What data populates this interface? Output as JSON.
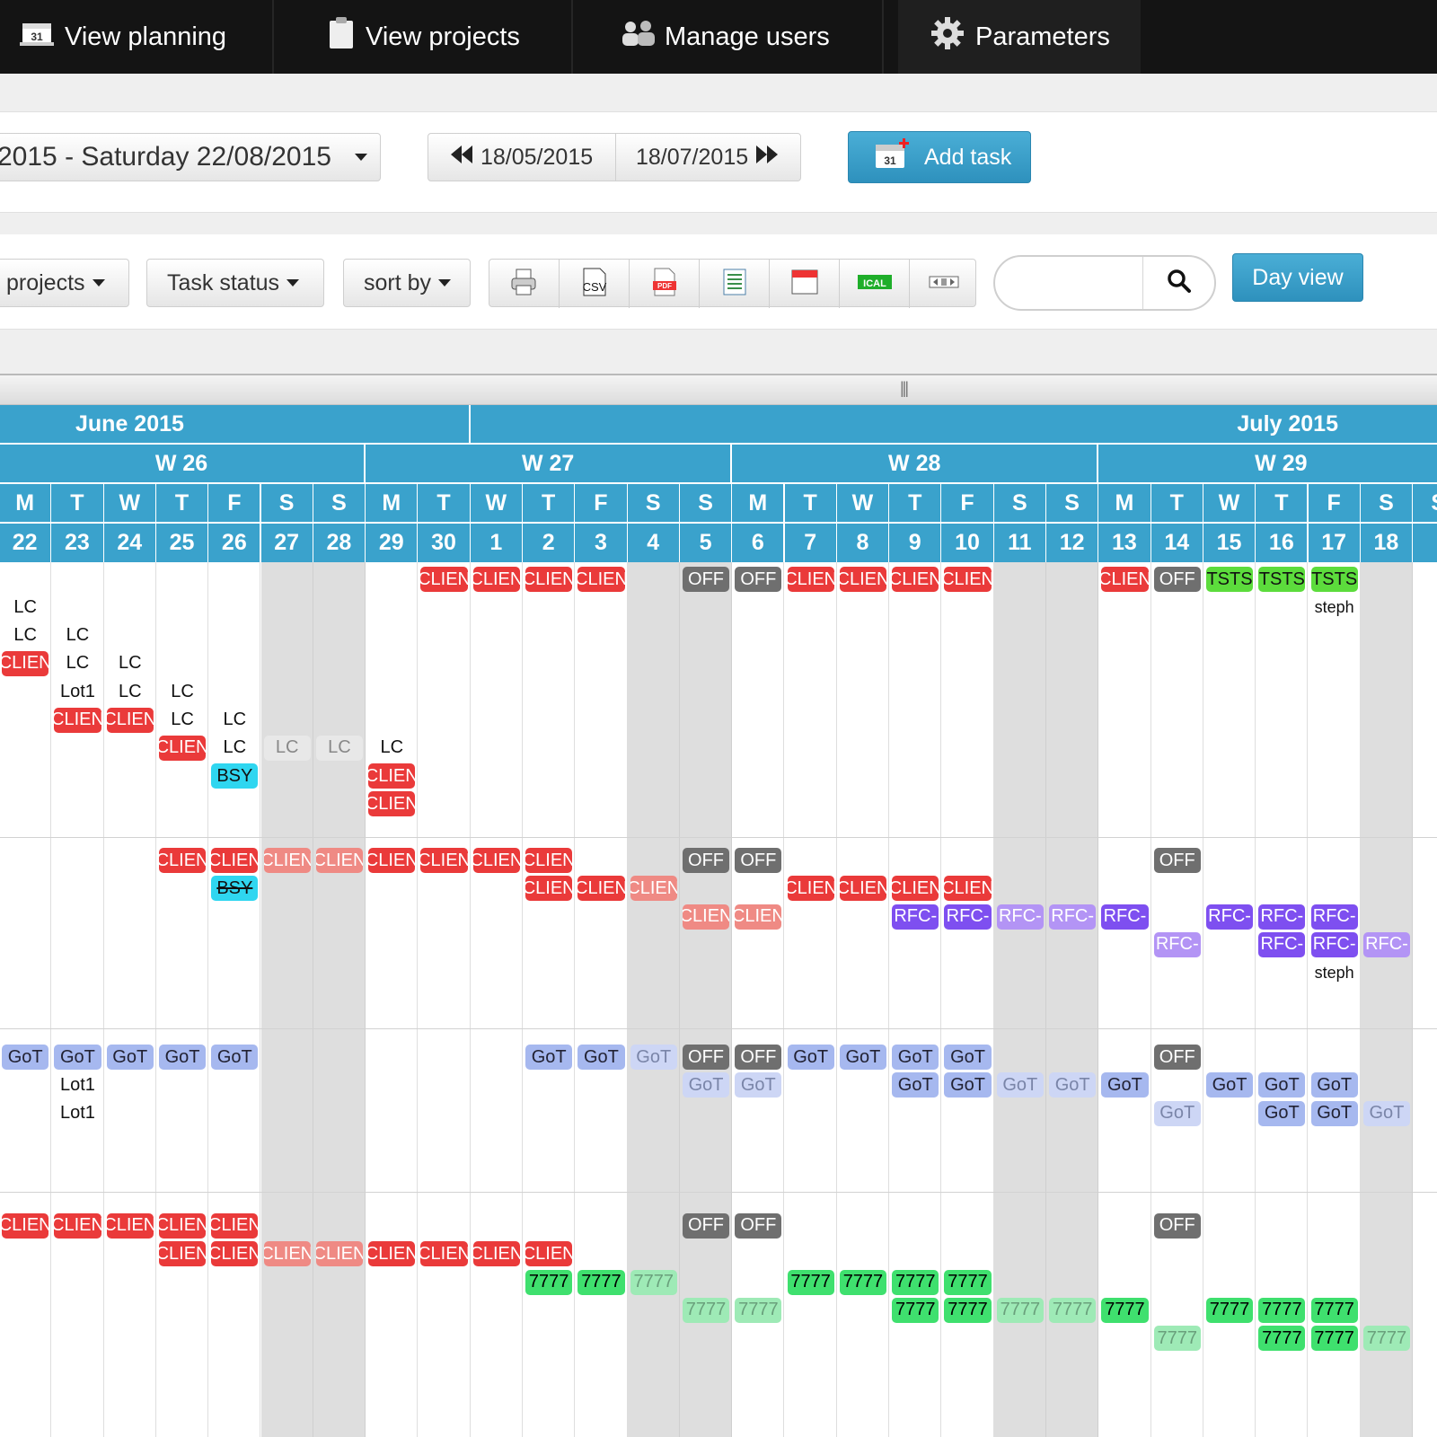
{
  "nav": {
    "items": [
      {
        "label": "View planning",
        "icon": "calendar-31-icon"
      },
      {
        "label": "View projects",
        "icon": "clipboard-icon"
      },
      {
        "label": "Manage users",
        "icon": "users-icon"
      },
      {
        "label": "Parameters",
        "icon": "gear-icon"
      }
    ]
  },
  "toolbar": {
    "date_range": "2015 - Saturday 22/08/2015",
    "prev_date": "18/05/2015",
    "next_date": "18/07/2015",
    "add_task": "Add task",
    "add_task_icon_text": "31"
  },
  "filters": {
    "projects": "projects",
    "task_status": "Task status",
    "sort_by": "sort by",
    "export_icons": [
      "print-icon",
      "csv-icon",
      "pdf-icon",
      "excel-icon",
      "calendar-export-icon",
      "ical-icon",
      "column-width-icon"
    ],
    "csv_text": "CSV",
    "pdf_text": "PDF",
    "ical_text": "ICAL",
    "search_value": "",
    "day_view": "Day view"
  },
  "calendar": {
    "months": [
      "June 2015",
      "July 2015"
    ],
    "weeks": [
      "W 26",
      "W 27",
      "W 28",
      "W 29"
    ],
    "day_letters": [
      "M",
      "T",
      "W",
      "T",
      "F",
      "S",
      "S",
      "M",
      "T",
      "W",
      "T",
      "F",
      "S",
      "S",
      "M",
      "T",
      "W",
      "T",
      "F",
      "S",
      "S",
      "M",
      "T",
      "W",
      "T",
      "F",
      "S",
      "S"
    ],
    "day_numbers": [
      "22",
      "23",
      "24",
      "25",
      "26",
      "27",
      "28",
      "29",
      "30",
      "1",
      "2",
      "3",
      "4",
      "5",
      "6",
      "7",
      "8",
      "9",
      "10",
      "11",
      "12",
      "13",
      "14",
      "15",
      "16",
      "17",
      "18"
    ],
    "weekend_columns": [
      5,
      6,
      12,
      13,
      19,
      20,
      26
    ],
    "colors": {
      "header": "#3aa2cc",
      "weekend": "#dedede",
      "clien": "#ea3a3a",
      "off": "#6f6f6f",
      "rfc": "#7e4ff0",
      "got": "#a6b8ef",
      "green": "#3fe06e",
      "tsts": "#5cdc3c",
      "bsy": "#2fd6f0"
    },
    "tasks": [
      {
        "c": 8,
        "r": 0,
        "t": "CLIEN",
        "s": "clien"
      },
      {
        "c": 9,
        "r": 0,
        "t": "CLIEN",
        "s": "clien"
      },
      {
        "c": 10,
        "r": 0,
        "t": "CLIEN",
        "s": "clien"
      },
      {
        "c": 11,
        "r": 0,
        "t": "CLIEN",
        "s": "clien"
      },
      {
        "c": 13,
        "r": 0,
        "t": "OFF",
        "s": "off"
      },
      {
        "c": 14,
        "r": 0,
        "t": "OFF",
        "s": "off"
      },
      {
        "c": 15,
        "r": 0,
        "t": "CLIEN",
        "s": "clien"
      },
      {
        "c": 16,
        "r": 0,
        "t": "CLIEN",
        "s": "clien"
      },
      {
        "c": 17,
        "r": 0,
        "t": "CLIEN",
        "s": "clien"
      },
      {
        "c": 18,
        "r": 0,
        "t": "CLIEN",
        "s": "clien"
      },
      {
        "c": 21,
        "r": 0,
        "t": "CLIEN",
        "s": "clien"
      },
      {
        "c": 22,
        "r": 0,
        "t": "OFF",
        "s": "off"
      },
      {
        "c": 23,
        "r": 0,
        "t": "TSTS",
        "s": "tsts"
      },
      {
        "c": 24,
        "r": 0,
        "t": "TSTS",
        "s": "tsts"
      },
      {
        "c": 25,
        "r": 0,
        "t": "TSTS",
        "s": "tsts"
      },
      {
        "c": 0,
        "r": 1,
        "t": "LC",
        "s": "lc"
      },
      {
        "c": 25,
        "r": 1,
        "t": "steph",
        "s": "steph"
      },
      {
        "c": 0,
        "r": 2,
        "t": "LC",
        "s": "lc"
      },
      {
        "c": 1,
        "r": 2,
        "t": "LC",
        "s": "lc"
      },
      {
        "c": 0,
        "r": 3,
        "t": "CLIEN",
        "s": "clien"
      },
      {
        "c": 1,
        "r": 3,
        "t": "LC",
        "s": "lc"
      },
      {
        "c": 2,
        "r": 3,
        "t": "LC",
        "s": "lc"
      },
      {
        "c": 1,
        "r": 4,
        "t": "Lot1",
        "s": "txt"
      },
      {
        "c": 2,
        "r": 4,
        "t": "LC",
        "s": "lc"
      },
      {
        "c": 3,
        "r": 4,
        "t": "LC",
        "s": "lc"
      },
      {
        "c": 1,
        "r": 5,
        "t": "CLIEN",
        "s": "clien"
      },
      {
        "c": 2,
        "r": 5,
        "t": "CLIEN",
        "s": "clien"
      },
      {
        "c": 3,
        "r": 5,
        "t": "LC",
        "s": "lc"
      },
      {
        "c": 4,
        "r": 5,
        "t": "LC",
        "s": "lc"
      },
      {
        "c": 3,
        "r": 6,
        "t": "CLIEN",
        "s": "clien"
      },
      {
        "c": 4,
        "r": 6,
        "t": "LC",
        "s": "lc"
      },
      {
        "c": 5,
        "r": 6,
        "t": "LC",
        "s": "lc-g"
      },
      {
        "c": 6,
        "r": 6,
        "t": "LC",
        "s": "lc-g"
      },
      {
        "c": 7,
        "r": 6,
        "t": "LC",
        "s": "lc"
      },
      {
        "c": 4,
        "r": 7,
        "t": "BSY",
        "s": "bsy"
      },
      {
        "c": 7,
        "r": 7,
        "t": "CLIEN",
        "s": "clien"
      },
      {
        "c": 7,
        "r": 8,
        "t": "CLIEN",
        "s": "clien"
      },
      {
        "c": 3,
        "r": 10,
        "t": "CLIEN",
        "s": "clien"
      },
      {
        "c": 4,
        "r": 10,
        "t": "CLIEN",
        "s": "clien"
      },
      {
        "c": 5,
        "r": 10,
        "t": "CLIEN",
        "s": "clien-l"
      },
      {
        "c": 6,
        "r": 10,
        "t": "CLIEN",
        "s": "clien-l"
      },
      {
        "c": 7,
        "r": 10,
        "t": "CLIEN",
        "s": "clien"
      },
      {
        "c": 8,
        "r": 10,
        "t": "CLIEN",
        "s": "clien"
      },
      {
        "c": 9,
        "r": 10,
        "t": "CLIEN",
        "s": "clien"
      },
      {
        "c": 10,
        "r": 10,
        "t": "CLIEN",
        "s": "clien"
      },
      {
        "c": 13,
        "r": 10,
        "t": "OFF",
        "s": "off"
      },
      {
        "c": 14,
        "r": 10,
        "t": "OFF",
        "s": "off"
      },
      {
        "c": 22,
        "r": 10,
        "t": "OFF",
        "s": "off"
      },
      {
        "c": 4,
        "r": 11,
        "t": "BSY",
        "s": "bsy-x"
      },
      {
        "c": 10,
        "r": 11,
        "t": "CLIEN",
        "s": "clien"
      },
      {
        "c": 11,
        "r": 11,
        "t": "CLIEN",
        "s": "clien"
      },
      {
        "c": 12,
        "r": 11,
        "t": "CLIEN",
        "s": "clien-l"
      },
      {
        "c": 15,
        "r": 11,
        "t": "CLIEN",
        "s": "clien"
      },
      {
        "c": 16,
        "r": 11,
        "t": "CLIEN",
        "s": "clien"
      },
      {
        "c": 17,
        "r": 11,
        "t": "CLIEN",
        "s": "clien"
      },
      {
        "c": 18,
        "r": 11,
        "t": "CLIEN",
        "s": "clien"
      },
      {
        "c": 13,
        "r": 12,
        "t": "CLIEN",
        "s": "clien-l"
      },
      {
        "c": 14,
        "r": 12,
        "t": "CLIEN",
        "s": "clien-l"
      },
      {
        "c": 17,
        "r": 12,
        "t": "RFC-",
        "s": "rfc"
      },
      {
        "c": 18,
        "r": 12,
        "t": "RFC-",
        "s": "rfc"
      },
      {
        "c": 19,
        "r": 12,
        "t": "RFC-",
        "s": "rfc-l"
      },
      {
        "c": 20,
        "r": 12,
        "t": "RFC-",
        "s": "rfc-l"
      },
      {
        "c": 21,
        "r": 12,
        "t": "RFC-",
        "s": "rfc"
      },
      {
        "c": 23,
        "r": 12,
        "t": "RFC-",
        "s": "rfc"
      },
      {
        "c": 24,
        "r": 12,
        "t": "RFC-",
        "s": "rfc"
      },
      {
        "c": 25,
        "r": 12,
        "t": "RFC-",
        "s": "rfc"
      },
      {
        "c": 22,
        "r": 13,
        "t": "RFC-",
        "s": "rfc-l"
      },
      {
        "c": 24,
        "r": 13,
        "t": "RFC-",
        "s": "rfc"
      },
      {
        "c": 25,
        "r": 13,
        "t": "RFC-",
        "s": "rfc"
      },
      {
        "c": 26,
        "r": 13,
        "t": "RFC-",
        "s": "rfc-l"
      },
      {
        "c": 25,
        "r": 14,
        "t": "steph",
        "s": "steph"
      },
      {
        "c": 0,
        "r": 17,
        "t": "GoT",
        "s": "got"
      },
      {
        "c": 1,
        "r": 17,
        "t": "GoT",
        "s": "got"
      },
      {
        "c": 2,
        "r": 17,
        "t": "GoT",
        "s": "got"
      },
      {
        "c": 3,
        "r": 17,
        "t": "GoT",
        "s": "got"
      },
      {
        "c": 4,
        "r": 17,
        "t": "GoT",
        "s": "got"
      },
      {
        "c": 10,
        "r": 17,
        "t": "GoT",
        "s": "got"
      },
      {
        "c": 11,
        "r": 17,
        "t": "GoT",
        "s": "got"
      },
      {
        "c": 12,
        "r": 17,
        "t": "GoT",
        "s": "got-l"
      },
      {
        "c": 13,
        "r": 17,
        "t": "OFF",
        "s": "off"
      },
      {
        "c": 14,
        "r": 17,
        "t": "OFF",
        "s": "off"
      },
      {
        "c": 15,
        "r": 17,
        "t": "GoT",
        "s": "got"
      },
      {
        "c": 16,
        "r": 17,
        "t": "GoT",
        "s": "got"
      },
      {
        "c": 17,
        "r": 17,
        "t": "GoT",
        "s": "got"
      },
      {
        "c": 18,
        "r": 17,
        "t": "GoT",
        "s": "got"
      },
      {
        "c": 22,
        "r": 17,
        "t": "OFF",
        "s": "off"
      },
      {
        "c": 1,
        "r": 18,
        "t": "Lot1",
        "s": "txt"
      },
      {
        "c": 13,
        "r": 18,
        "t": "GoT",
        "s": "got-l"
      },
      {
        "c": 14,
        "r": 18,
        "t": "GoT",
        "s": "got-l"
      },
      {
        "c": 17,
        "r": 18,
        "t": "GoT",
        "s": "got"
      },
      {
        "c": 18,
        "r": 18,
        "t": "GoT",
        "s": "got"
      },
      {
        "c": 19,
        "r": 18,
        "t": "GoT",
        "s": "got-l"
      },
      {
        "c": 20,
        "r": 18,
        "t": "GoT",
        "s": "got-l"
      },
      {
        "c": 21,
        "r": 18,
        "t": "GoT",
        "s": "got"
      },
      {
        "c": 23,
        "r": 18,
        "t": "GoT",
        "s": "got"
      },
      {
        "c": 24,
        "r": 18,
        "t": "GoT",
        "s": "got"
      },
      {
        "c": 25,
        "r": 18,
        "t": "GoT",
        "s": "got"
      },
      {
        "c": 1,
        "r": 19,
        "t": "Lot1",
        "s": "txt"
      },
      {
        "c": 22,
        "r": 19,
        "t": "GoT",
        "s": "got-l"
      },
      {
        "c": 24,
        "r": 19,
        "t": "GoT",
        "s": "got"
      },
      {
        "c": 25,
        "r": 19,
        "t": "GoT",
        "s": "got"
      },
      {
        "c": 26,
        "r": 19,
        "t": "GoT",
        "s": "got-l"
      },
      {
        "c": 0,
        "r": 23,
        "t": "CLIEN",
        "s": "clien"
      },
      {
        "c": 1,
        "r": 23,
        "t": "CLIEN",
        "s": "clien"
      },
      {
        "c": 2,
        "r": 23,
        "t": "CLIEN",
        "s": "clien"
      },
      {
        "c": 3,
        "r": 23,
        "t": "CLIEN",
        "s": "clien"
      },
      {
        "c": 4,
        "r": 23,
        "t": "CLIEN",
        "s": "clien"
      },
      {
        "c": 13,
        "r": 23,
        "t": "OFF",
        "s": "off"
      },
      {
        "c": 14,
        "r": 23,
        "t": "OFF",
        "s": "off"
      },
      {
        "c": 22,
        "r": 23,
        "t": "OFF",
        "s": "off"
      },
      {
        "c": 3,
        "r": 24,
        "t": "CLIEN",
        "s": "clien"
      },
      {
        "c": 4,
        "r": 24,
        "t": "CLIEN",
        "s": "clien"
      },
      {
        "c": 5,
        "r": 24,
        "t": "CLIEN",
        "s": "clien-l"
      },
      {
        "c": 6,
        "r": 24,
        "t": "CLIEN",
        "s": "clien-l"
      },
      {
        "c": 7,
        "r": 24,
        "t": "CLIEN",
        "s": "clien"
      },
      {
        "c": 8,
        "r": 24,
        "t": "CLIEN",
        "s": "clien"
      },
      {
        "c": 9,
        "r": 24,
        "t": "CLIEN",
        "s": "clien"
      },
      {
        "c": 10,
        "r": 24,
        "t": "CLIEN",
        "s": "clien"
      },
      {
        "c": 10,
        "r": 25,
        "t": "7777",
        "s": "g"
      },
      {
        "c": 11,
        "r": 25,
        "t": "7777",
        "s": "g"
      },
      {
        "c": 12,
        "r": 25,
        "t": "7777",
        "s": "g-l"
      },
      {
        "c": 15,
        "r": 25,
        "t": "7777",
        "s": "g"
      },
      {
        "c": 16,
        "r": 25,
        "t": "7777",
        "s": "g"
      },
      {
        "c": 17,
        "r": 25,
        "t": "7777",
        "s": "g"
      },
      {
        "c": 18,
        "r": 25,
        "t": "7777",
        "s": "g"
      },
      {
        "c": 13,
        "r": 26,
        "t": "7777",
        "s": "g-l"
      },
      {
        "c": 14,
        "r": 26,
        "t": "7777",
        "s": "g-l"
      },
      {
        "c": 17,
        "r": 26,
        "t": "7777",
        "s": "g"
      },
      {
        "c": 18,
        "r": 26,
        "t": "7777",
        "s": "g"
      },
      {
        "c": 19,
        "r": 26,
        "t": "7777",
        "s": "g-l"
      },
      {
        "c": 20,
        "r": 26,
        "t": "7777",
        "s": "g-l"
      },
      {
        "c": 21,
        "r": 26,
        "t": "7777",
        "s": "g"
      },
      {
        "c": 23,
        "r": 26,
        "t": "7777",
        "s": "g"
      },
      {
        "c": 24,
        "r": 26,
        "t": "7777",
        "s": "g"
      },
      {
        "c": 25,
        "r": 26,
        "t": "7777",
        "s": "g"
      },
      {
        "c": 22,
        "r": 27,
        "t": "7777",
        "s": "g-l"
      },
      {
        "c": 24,
        "r": 27,
        "t": "7777",
        "s": "g"
      },
      {
        "c": 25,
        "r": 27,
        "t": "7777",
        "s": "g"
      },
      {
        "c": 26,
        "r": 27,
        "t": "7777",
        "s": "g-l"
      }
    ]
  }
}
